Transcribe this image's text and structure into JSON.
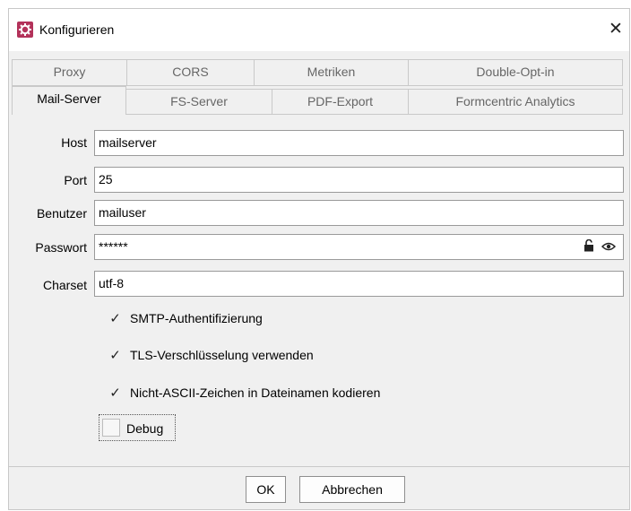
{
  "window": {
    "title": "Konfigurieren",
    "close_glyph": "✕",
    "app_icon": "gear-icon",
    "brand_color": "#b3325a"
  },
  "tabs": {
    "row1": [
      {
        "label": "Proxy"
      },
      {
        "label": "CORS"
      },
      {
        "label": "Metriken"
      },
      {
        "label": "Double-Opt-in"
      }
    ],
    "row2": [
      {
        "label": "Mail-Server",
        "active": true
      },
      {
        "label": "FS-Server"
      },
      {
        "label": "PDF-Export"
      },
      {
        "label": "Formcentric Analytics"
      }
    ]
  },
  "form": {
    "host": {
      "label": "Host",
      "value": "mailserver"
    },
    "port": {
      "label": "Port",
      "value": "25"
    },
    "user": {
      "label": "Benutzer",
      "value": "mailuser"
    },
    "password": {
      "label": "Passwort",
      "value": "******",
      "icons": [
        "lock-open-icon",
        "eye-icon"
      ]
    },
    "charset": {
      "label": "Charset",
      "value": "utf-8"
    }
  },
  "checkboxes": [
    {
      "label": "SMTP-Authentifizierung",
      "checked": true
    },
    {
      "label": "TLS-Verschlüsselung verwenden",
      "checked": true
    },
    {
      "label": "Nicht-ASCII-Zeichen in Dateinamen kodieren",
      "checked": true
    },
    {
      "label": "Debug",
      "checked": false
    }
  ],
  "check_glyph": "✓",
  "buttons": {
    "ok": "OK",
    "cancel": "Abbrechen"
  }
}
